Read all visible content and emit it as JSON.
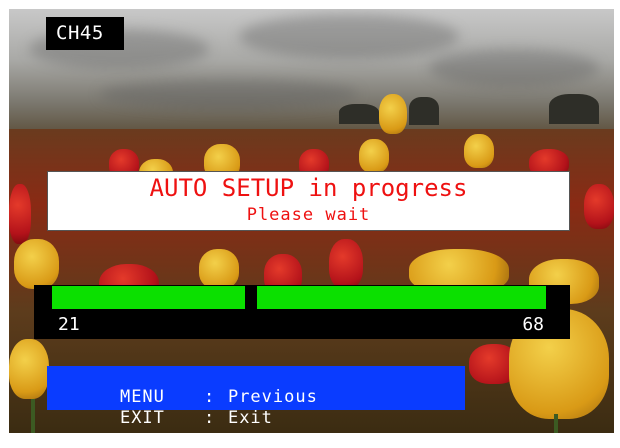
{
  "channel": {
    "label": "CH45"
  },
  "message": {
    "title": "AUTO SETUP in progress",
    "subtitle": "Please wait",
    "text_color": "#ee1111"
  },
  "progress": {
    "start_label": "21",
    "end_label": "68",
    "bar_color": "#0be000"
  },
  "menu": {
    "items": [
      {
        "key": "MENU",
        "separator": ":",
        "action": "Previous"
      },
      {
        "key": "EXIT",
        "separator": ":",
        "action": "Exit"
      }
    ],
    "background": "#0a3cff"
  }
}
